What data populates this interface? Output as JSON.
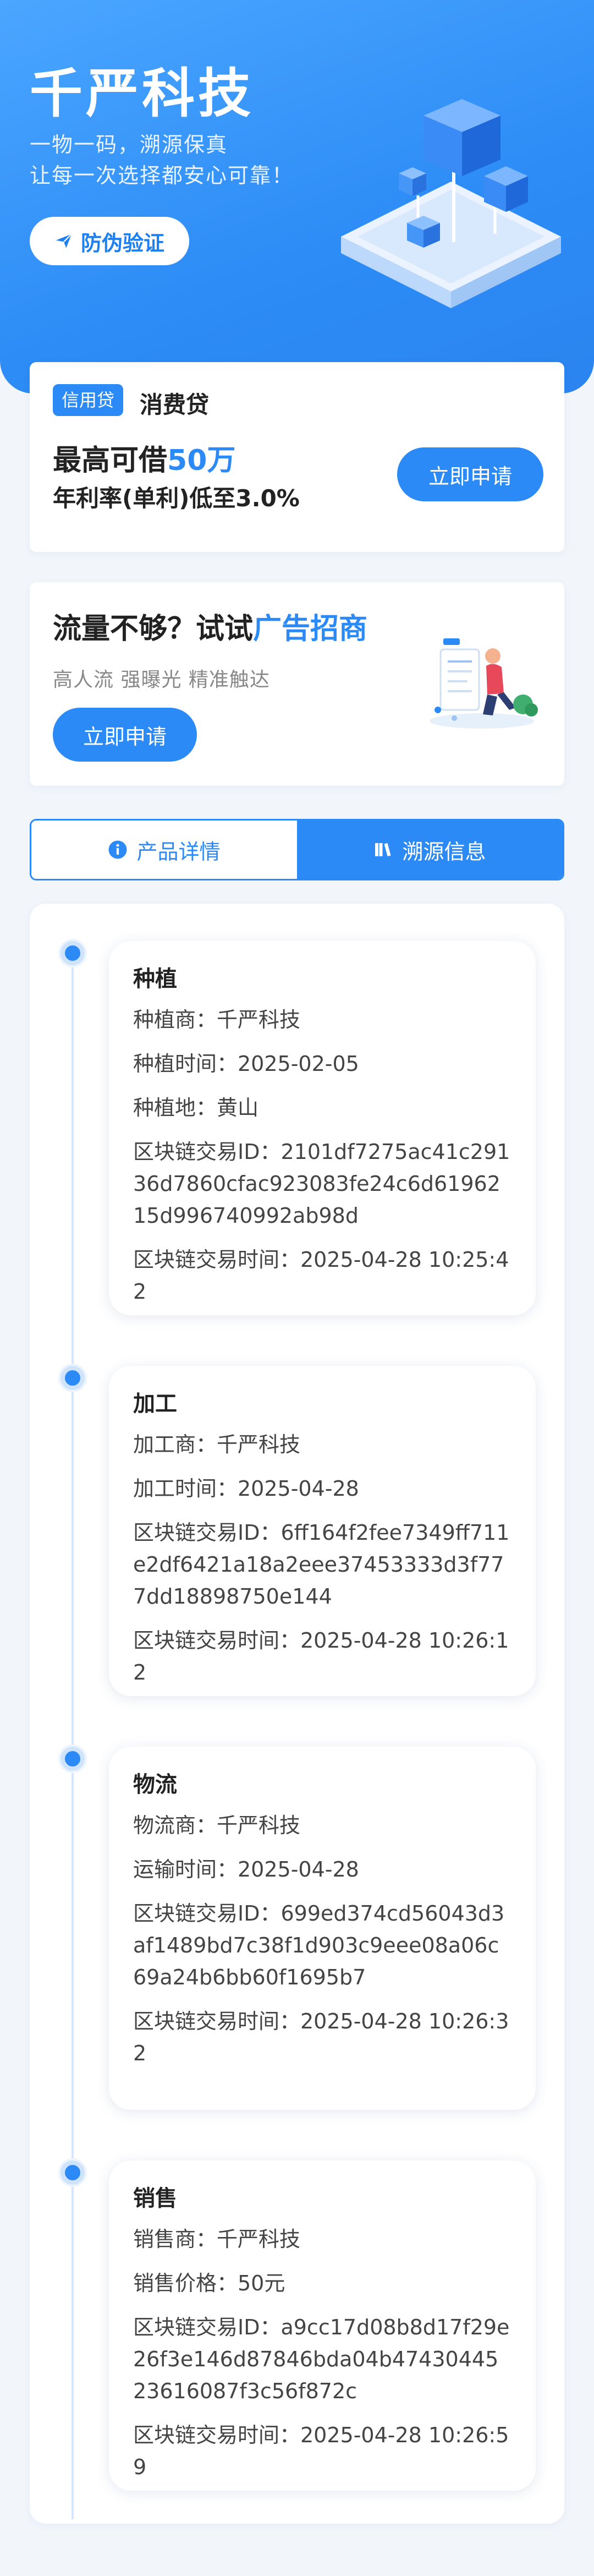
{
  "hero": {
    "title": "千严科技",
    "subtitle_1": "一物一码，溯源保真",
    "subtitle_2": "让每一次选择都安心可靠！",
    "verify_label": "防伪验证"
  },
  "loan": {
    "tag": "信用贷",
    "name": "消费贷",
    "amount_prefix": "最高可借",
    "amount_value": "50万",
    "rate": "年利率(单利)低至3.0%",
    "apply_label": "立即申请"
  },
  "ad": {
    "title_prefix": "流量不够？试试",
    "title_highlight": "广告招商",
    "subtitle": "高人流 强曝光 精准触达",
    "apply_label": "立即申请"
  },
  "tabs": [
    {
      "label": "产品详情",
      "icon": "info-icon",
      "active": false
    },
    {
      "label": "溯源信息",
      "icon": "book-icon",
      "active": true
    }
  ],
  "trace": [
    {
      "title": "种植",
      "rows": [
        "种植商：千严科技",
        "种植时间：2025-02-05",
        "种植地：黄山",
        "区块链交易ID：2101df7275ac41c29136d7860cfac923083fe24c6d6196215d996740992ab98d",
        "区块链交易时间：2025-04-28 10:25:42"
      ]
    },
    {
      "title": "加工",
      "rows": [
        "加工商：千严科技",
        "加工时间：2025-04-28",
        "区块链交易ID：6ff164f2fee7349ff711e2df6421a18a2eee37453333d3f777dd18898750e144",
        "区块链交易时间：2025-04-28 10:26:12"
      ]
    },
    {
      "title": "物流",
      "rows": [
        "物流商：千严科技",
        "运输时间：2025-04-28",
        "区块链交易ID：699ed374cd56043d3af1489bd7c38f1d903c9eee08a06c69a24b6bb60f1695b7",
        "区块链交易时间：2025-04-28 10:26:32"
      ]
    },
    {
      "title": "销售",
      "rows": [
        "销售商：千严科技",
        "销售价格：50元",
        "区块链交易ID：a9cc17d08b8d17f29e26f3e146d87846bda04b4743044523616087f3c56f872c",
        "区块链交易时间：2025-04-28 10:26:59"
      ]
    }
  ],
  "colors": {
    "accent": "#2b8af5",
    "hero_start": "#4aa6ff",
    "hero_end": "#2b84ef"
  }
}
